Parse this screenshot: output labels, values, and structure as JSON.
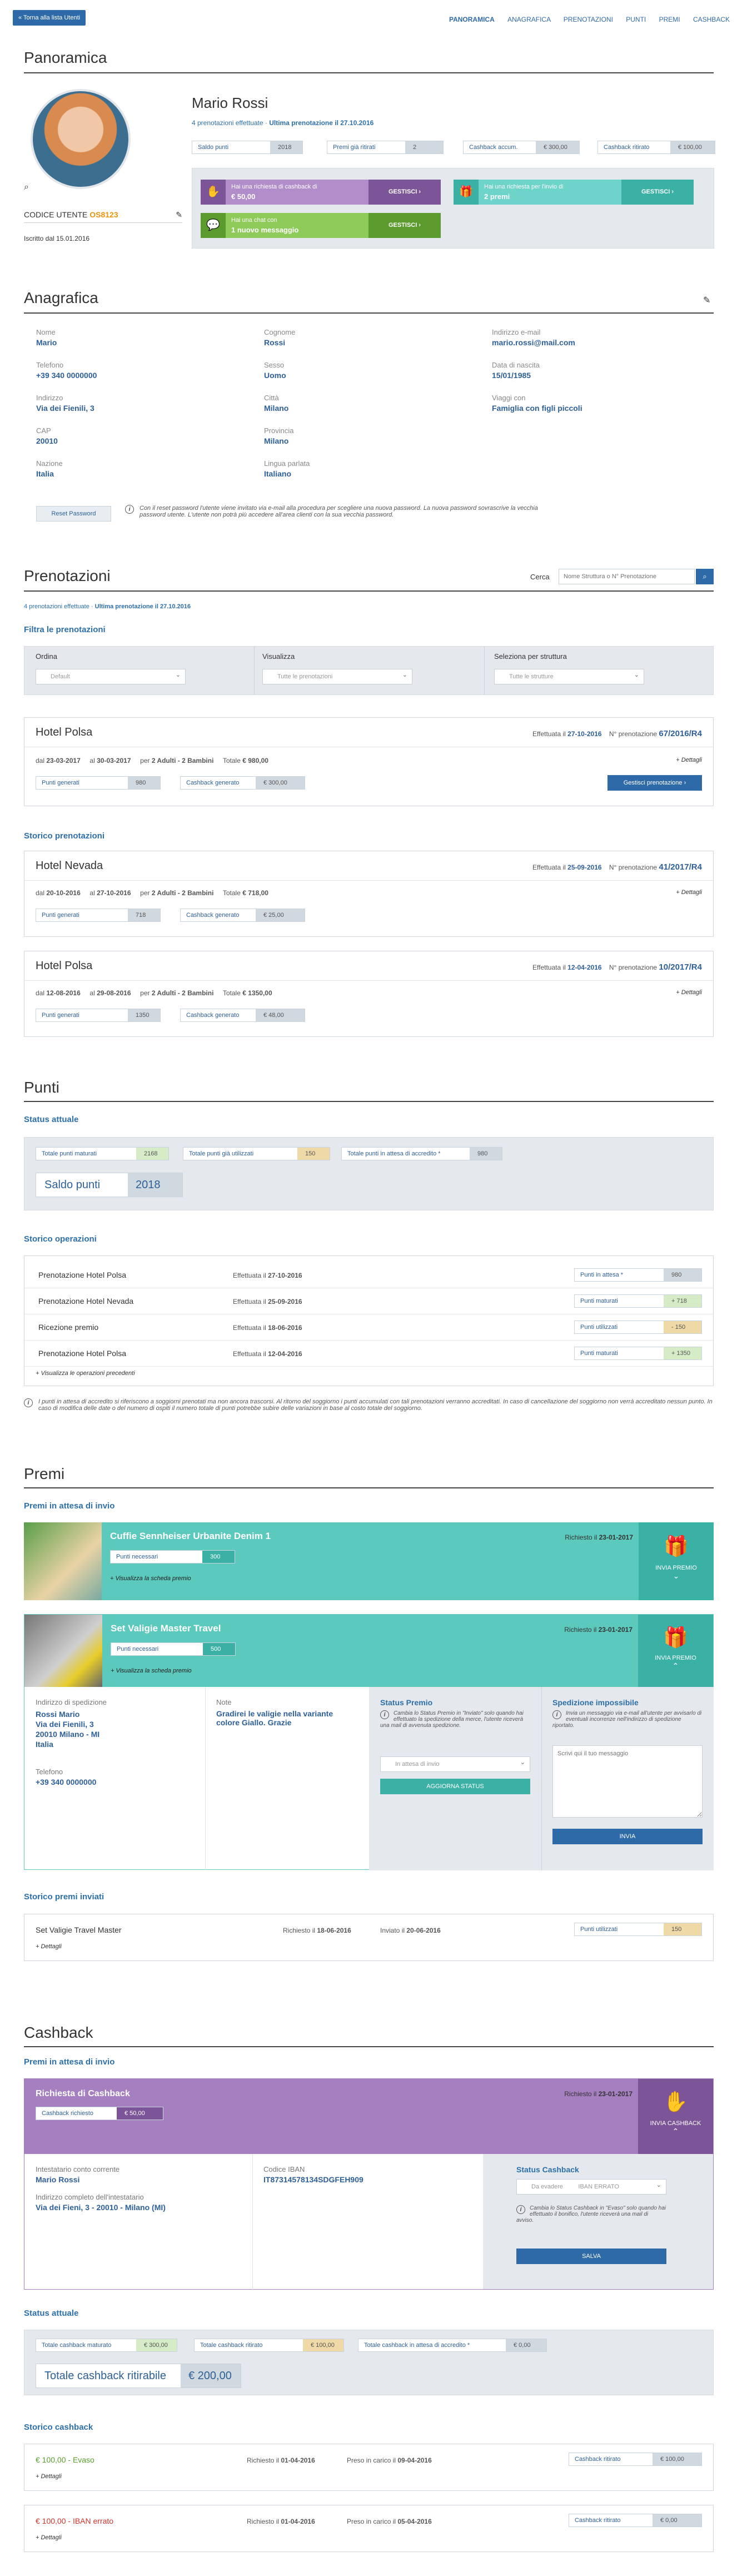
{
  "nav": {
    "back": "« Torna alla lista Utenti",
    "items": [
      "PANORAMICA",
      "ANAGRAFICA",
      "PRENOTAZIONI",
      "PUNTI",
      "PREMI",
      "CASHBACK"
    ]
  },
  "panoramica": {
    "title": "Panoramica",
    "name": "Mario Rossi",
    "subline_a": "4 prenotazioni effettuate",
    "subline_sep": " · ",
    "subline_b": "Ultima prenotazione il 27.10.2016",
    "code_label": "CODICE UTENTE",
    "code": "OS8123",
    "registered": "Iscritto dal 15.01.2016",
    "stats": [
      {
        "k": "Saldo punti",
        "v": "2018"
      },
      {
        "k": "Premi già ritirati",
        "v": "2"
      },
      {
        "k": "Cashback accum.",
        "v": "€ 300,00"
      },
      {
        "k": "Cashback ritirato",
        "v": "€ 100,00"
      }
    ],
    "alerts": [
      {
        "t1": "Hai una richiesta di cashback di",
        "t2": "€ 50,00",
        "btn": "GESTISCI"
      },
      {
        "t1": "Hai una richiesta per l'invio di",
        "t2": "2 premi",
        "btn": "GESTISCI"
      },
      {
        "t1": "Hai una chat con",
        "t2": "1 nuovo messaggio",
        "btn": "GESTISCI"
      }
    ]
  },
  "anagrafica": {
    "title": "Anagrafica",
    "fields": [
      {
        "l": "Nome",
        "v": "Mario"
      },
      {
        "l": "Cognome",
        "v": "Rossi"
      },
      {
        "l": "Indirizzo e-mail",
        "v": "mario.rossi@mail.com"
      },
      {
        "l": "Telefono",
        "v": "+39 340 0000000"
      },
      {
        "l": "Sesso",
        "v": "Uomo"
      },
      {
        "l": "Data di nascita",
        "v": "15/01/1985"
      },
      {
        "l": "Indirizzo",
        "v": "Via dei Fienili, 3"
      },
      {
        "l": "Città",
        "v": "Milano"
      },
      {
        "l": "Viaggi con",
        "v": "Famiglia con figli piccoli"
      },
      {
        "l": "CAP",
        "v": "20010"
      },
      {
        "l": "Provincia",
        "v": "Milano"
      },
      {
        "l": "",
        "v": ""
      },
      {
        "l": "Nazione",
        "v": "Italia"
      },
      {
        "l": "Lingua parlata",
        "v": "Italiano"
      },
      {
        "l": "",
        "v": ""
      }
    ],
    "reset": "Reset Password",
    "reset_note": "Con il reset password l'utente viene invitato via e-mail alla procedura per scegliere una nuova password. La nuova password sovrascrive la vecchia password utente. L'utente non potrà più accedere all'area clienti con la sua vecchia password."
  },
  "prenotazioni": {
    "title": "Prenotazioni",
    "search_label": "Cerca",
    "search_ph": "Nome Struttura o N° Prenotazione",
    "subline_a": "4 prenotazioni effettuate",
    "subline_b": "Ultima prenotazione il 27.10.2016",
    "filter_title": "Filtra le prenotazioni",
    "filters": [
      {
        "l": "Ordina",
        "ph": "Default"
      },
      {
        "l": "Visualizza",
        "ph": "Tutte le prenotazioni"
      },
      {
        "l": "Seleziona per struttura",
        "ph": "Tutte le strutture"
      }
    ],
    "current": {
      "hotel": "Hotel Polsa",
      "eff_l": "Effettuata il",
      "eff": "27-10-2016",
      "num_l": "N° prenotazione",
      "num": "67/2016/R4",
      "dal_l": "dal",
      "dal": "23-03-2017",
      "al_l": "al",
      "al": "30-03-2017",
      "per_l": "per",
      "per": "2 Adulti - 2 Bambini",
      "tot_l": "Totale",
      "tot": "€ 980,00",
      "details": "+ Dettagli",
      "pk": "Punti generati",
      "pv": "980",
      "ck": "Cashback generato",
      "cv": "€ 300,00",
      "btn": "Gestisci prenotazione ›"
    },
    "history_title": "Storico prenotazioni",
    "history": [
      {
        "hotel": "Hotel Nevada",
        "eff": "25-09-2016",
        "num": "41/2017/R4",
        "dal": "20-10-2016",
        "al": "27-10-2016",
        "per": "2 Adulti - 2 Bambini",
        "tot": "€ 718,00",
        "pv": "718",
        "cv": "€ 25,00"
      },
      {
        "hotel": "Hotel Polsa",
        "eff": "12-04-2016",
        "num": "10/2017/R4",
        "dal": "12-08-2016",
        "al": "29-08-2016",
        "per": "2 Adulti - 2 Bambini",
        "tot": "€ 1350,00",
        "pv": "1350",
        "cv": "€ 48,00"
      }
    ]
  },
  "punti": {
    "title": "Punti",
    "status_title": "Status attuale",
    "stats": [
      {
        "k": "Totale punti maturati",
        "v": "2168"
      },
      {
        "k": "Totale punti già utilizzati",
        "v": "150"
      },
      {
        "k": "Totale punti in attesa di accredito *",
        "v": "980"
      }
    ],
    "saldo_k": "Saldo punti",
    "saldo_v": "2018",
    "ops_title": "Storico operazioni",
    "ops": [
      {
        "n": "Prenotazione Hotel Polsa",
        "d": "27-10-2016",
        "k": "Punti in attesa *",
        "v": "980"
      },
      {
        "n": "Prenotazione Hotel Nevada",
        "d": "25-09-2016",
        "k": "Punti maturati",
        "v": "+ 718"
      },
      {
        "n": "Ricezione premio",
        "d": "18-06-2016",
        "k": "Punti utilizzati",
        "v": "- 150"
      },
      {
        "n": "Prenotazione Hotel Polsa",
        "d": "12-04-2016",
        "k": "Punti maturati",
        "v": "+ 1350"
      }
    ],
    "ops_eff": "Effettuata il",
    "more": "+ Visualizza le operazioni precedenti",
    "note": "I punti in attesa di accredito si riferiscono a soggiorni prenotati ma non ancora trascorsi. Al ritorno del soggiorno i punti accumulati con tali prenotazioni verranno accreditati. In caso di cancellazione del soggiorno non verrà accreditato nessun punto. In caso di modifica delle date o del numero di ospiti il numero totale di punti potrebbe subire delle variazioni in base al costo totale del soggiorno."
  },
  "premi": {
    "title": "Premi",
    "wait_title": "Premi in attesa di invio",
    "items": [
      {
        "name": "Cuffie Sennheiser Urbanite Denim 1",
        "pk": "Punti necessari",
        "pv": "300",
        "req_l": "Richiesto il",
        "req": "23-01-2017",
        "link": "+ Visualizza la scheda premio",
        "btn": "INVIA PREMIO"
      },
      {
        "name": "Set Valigie Master Travel",
        "pk": "Punti necessari",
        "pv": "500",
        "req_l": "Richiesto il",
        "req": "23-01-2017",
        "link": "+ Visualizza la scheda premio",
        "btn": "INVIA PREMIO"
      }
    ],
    "ship_l": "Indirizzo di spedizione",
    "ship": [
      "Rossi Mario",
      "Via dei Fienili, 3",
      "20010 Milano - MI",
      "Italia"
    ],
    "tel_l": "Telefono",
    "tel": "+39 340 0000000",
    "note_l": "Note",
    "note": "Gradirei le valigie nella variante colore Giallo. Grazie",
    "status_l": "Status Premio",
    "status_note": "Cambia lo Status Premio in \"Inviato\" solo quando hai effettuato la spedizione della merce, l'utente riceverà una mail di avvenuta spedizione.",
    "status_ph": "In attesa di invio",
    "status_btn": "AGGIORNA STATUS",
    "imp_l": "Spedizione impossibile",
    "imp_note": "Invia un messaggio via e-mail all'utente per avvisarlo di eventuali incorrenze nell'indirizzo di spedizione riportato.",
    "imp_ph": "Scrivi qui il tuo messaggio",
    "imp_btn": "INVIA",
    "hist_title": "Storico premi inviati",
    "hist": {
      "name": "Set Valigie Travel Master",
      "req_l": "Richiesto il",
      "req": "18-06-2016",
      "sent_l": "Inviato il",
      "sent": "20-06-2016",
      "k": "Punti utilizzati",
      "v": "150",
      "details": "+ Dettagli"
    }
  },
  "cashback": {
    "title": "Cashback",
    "wait_title": "Premi in attesa di invio",
    "req_title": "Richiesta di Cashback",
    "rk": "Cashback richiesto",
    "rv": "€ 50,00",
    "req_l": "Richiesto il",
    "req": "23-01-2017",
    "btn": "INVIA CASHBACK",
    "holder_l": "Intestatario conto corrente",
    "holder": "Mario Rossi",
    "iban_l": "Codice IBAN",
    "iban": "IT87314578134SDGFEH909",
    "addr_l": "Indirizzo completo dell'intestatario",
    "addr": "Via dei Fieni, 3 - 20010 - Milano (MI)",
    "st_l": "Status Cashback",
    "st_ph": "Da evadere",
    "st_ph2": "IBAN ERRATO",
    "st_note": "Cambia lo Status Cashback in \"Evaso\" solo quando hai effettuato il bonifico, l'utente riceverà una mail di avviso.",
    "save": "SALVA",
    "status_title": "Status attuale",
    "stats": [
      {
        "k": "Totale cashback maturato",
        "v": "€ 300,00"
      },
      {
        "k": "Totale cashback ritirato",
        "v": "€ 100,00"
      },
      {
        "k": "Totale cashback in attesa di accredito *",
        "v": "€ 0,00"
      }
    ],
    "rit_k": "Totale cashback ritirabile",
    "rit_v": "€ 200,00",
    "hist_title": "Storico cashback",
    "hist": [
      {
        "t": "€ 100,00 - Evaso",
        "req": "01-04-2016",
        "car": "09-04-2016",
        "k": "Cashback ritirato",
        "v": "€ 100,00"
      },
      {
        "t": "€ 100,00 - IBAN errato",
        "req": "01-04-2016",
        "car": "05-04-2016",
        "k": "Cashback ritirato",
        "v": "€ 0,00"
      }
    ],
    "hist_req_l": "Richiesto il",
    "hist_car_l": "Preso in carico il",
    "details": "+ Dettagli"
  }
}
